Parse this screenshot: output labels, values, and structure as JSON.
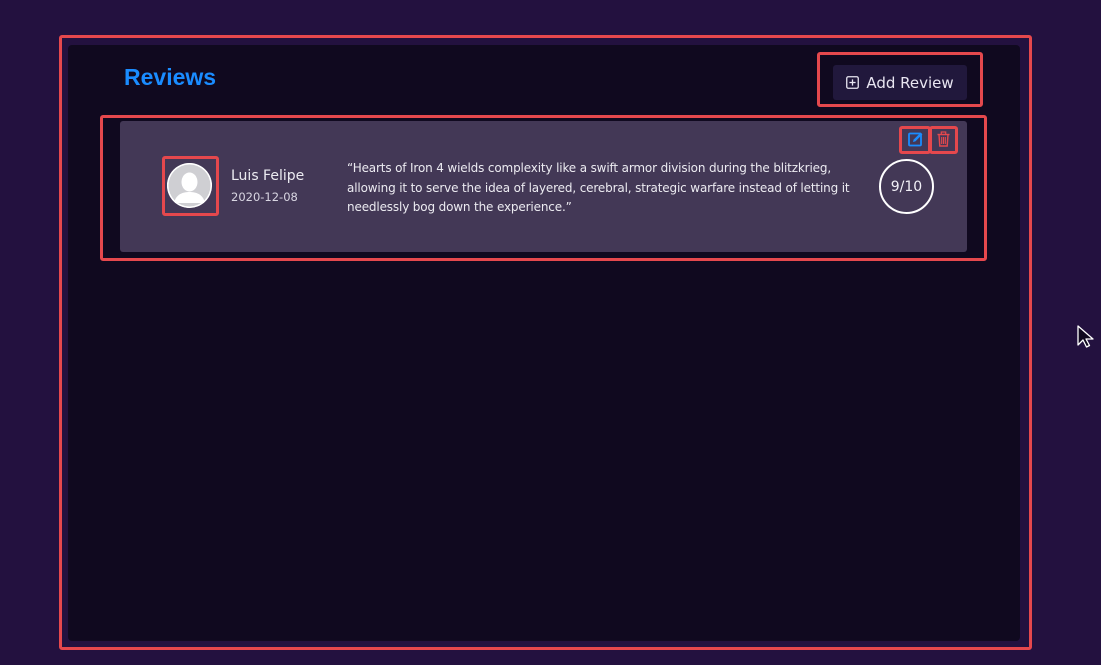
{
  "section": {
    "title": "Reviews",
    "add_button_label": "Add Review"
  },
  "reviews": [
    {
      "reviewer": "Luis Felipe",
      "date": "2020-12-08",
      "text": "“Hearts of Iron 4 wields complexity like a swift armor division during the blitzkrieg, allowing it to serve the idea of layered, cerebral, strategic warfare instead of letting it needlessly bog down the experience.”",
      "score": "9/10"
    }
  ],
  "icons": {
    "add": "plus-square-icon",
    "edit": "edit-icon",
    "delete": "trash-icon",
    "avatar": "user-avatar-icon",
    "cursor": "mouse-cursor-icon"
  },
  "colors": {
    "background": "#23113f",
    "panel": "#10091f",
    "card": "#433856",
    "accent": "#1a8cff",
    "highlight": "#e5484d",
    "delete": "#e5484d"
  }
}
